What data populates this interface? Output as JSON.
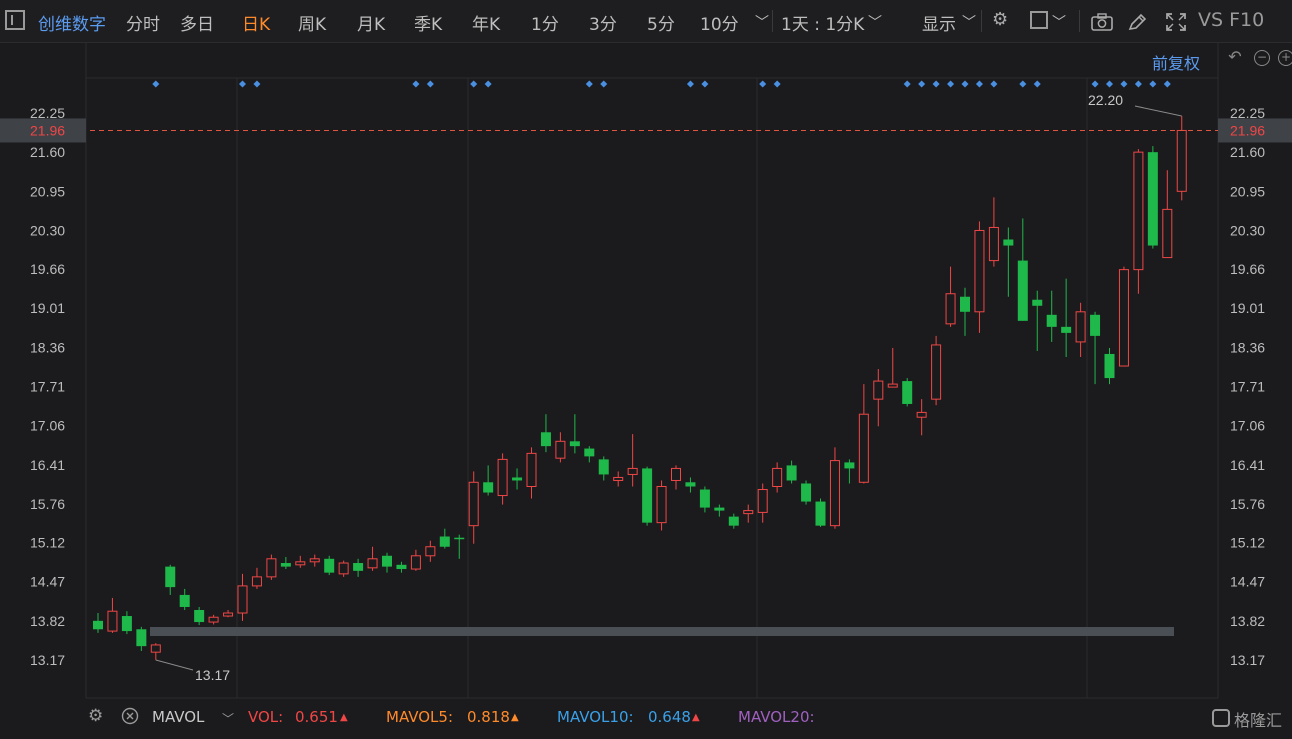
{
  "toolbar": {
    "stock_name": "创维数字",
    "periods": [
      "分时",
      "多日",
      "日K",
      "周K",
      "月K",
      "季K",
      "年K",
      "1分",
      "3分",
      "5分",
      "10分"
    ],
    "active_period": "日K",
    "more_chevron": "chevron-down-icon",
    "range": "1天 : 1分K",
    "display": "显示",
    "right_label": "VS F10",
    "icons": [
      "settings-icon",
      "checkbox-icon",
      "camera-icon",
      "pen-icon",
      "fullscreen-icon"
    ]
  },
  "subbar": {
    "adjust_label": "前复权",
    "icons": [
      "undo-icon",
      "zoom-out-icon",
      "zoom-in-icon"
    ]
  },
  "colors": {
    "up": "#f04646",
    "down": "#1fb84a",
    "price_line": "#e0553f",
    "marker": "#4a90e2",
    "grid": "#2b2b2e"
  },
  "chart_data": {
    "type": "candlestick",
    "y_ticks": [
      "22.25",
      "21.60",
      "20.95",
      "20.30",
      "19.66",
      "19.01",
      "18.36",
      "17.71",
      "17.06",
      "16.41",
      "15.76",
      "15.12",
      "14.47",
      "13.82",
      "13.17"
    ],
    "ylim": [
      12.6,
      22.6
    ],
    "current_price": "21.96",
    "high_label": "22.20",
    "low_label": "13.17",
    "candles": [
      [
        13.82,
        13.68,
        13.95,
        13.62
      ],
      [
        13.65,
        13.98,
        14.2,
        13.62
      ],
      [
        13.9,
        13.65,
        13.98,
        13.6
      ],
      [
        13.68,
        13.4,
        13.72,
        13.32
      ],
      [
        13.3,
        13.42,
        13.45,
        13.17
      ],
      [
        14.72,
        14.38,
        14.75,
        14.25
      ],
      [
        14.25,
        14.05,
        14.35,
        14.0
      ],
      [
        14.0,
        13.8,
        14.05,
        13.75
      ],
      [
        13.8,
        13.88,
        13.92,
        13.76
      ],
      [
        13.9,
        13.95,
        14.0,
        13.88
      ],
      [
        13.95,
        14.4,
        14.6,
        13.82
      ],
      [
        14.4,
        14.55,
        14.7,
        14.35
      ],
      [
        14.55,
        14.85,
        14.92,
        14.5
      ],
      [
        14.78,
        14.72,
        14.88,
        14.68
      ],
      [
        14.75,
        14.8,
        14.9,
        14.7
      ],
      [
        14.8,
        14.85,
        14.92,
        14.72
      ],
      [
        14.85,
        14.62,
        14.9,
        14.58
      ],
      [
        14.6,
        14.78,
        14.82,
        14.55
      ],
      [
        14.78,
        14.65,
        14.85,
        14.55
      ],
      [
        14.7,
        14.85,
        15.05,
        14.65
      ],
      [
        14.9,
        14.72,
        14.95,
        14.62
      ],
      [
        14.75,
        14.68,
        14.8,
        14.62
      ],
      [
        14.68,
        14.9,
        15.0,
        14.65
      ],
      [
        14.9,
        15.05,
        15.15,
        14.8
      ],
      [
        15.22,
        15.05,
        15.35,
        15.02
      ],
      [
        15.2,
        15.18,
        15.25,
        14.85
      ],
      [
        15.4,
        16.12,
        16.3,
        15.1
      ],
      [
        16.12,
        15.95,
        16.4,
        15.9
      ],
      [
        15.9,
        16.5,
        16.6,
        15.75
      ],
      [
        16.2,
        16.15,
        16.35,
        16.0
      ],
      [
        16.05,
        16.6,
        16.7,
        15.85
      ],
      [
        16.95,
        16.72,
        17.25,
        16.62
      ],
      [
        16.52,
        16.8,
        16.95,
        16.45
      ],
      [
        16.8,
        16.72,
        17.25,
        16.6
      ],
      [
        16.68,
        16.55,
        16.72,
        16.45
      ],
      [
        16.5,
        16.25,
        16.55,
        16.15
      ],
      [
        16.15,
        16.2,
        16.3,
        16.05
      ],
      [
        16.25,
        16.35,
        16.92,
        16.05
      ],
      [
        16.35,
        15.45,
        16.38,
        15.4
      ],
      [
        15.45,
        16.05,
        16.15,
        15.32
      ],
      [
        16.15,
        16.35,
        16.4,
        16.0
      ],
      [
        16.12,
        16.05,
        16.2,
        15.95
      ],
      [
        16.0,
        15.7,
        16.05,
        15.62
      ],
      [
        15.7,
        15.65,
        15.75,
        15.55
      ],
      [
        15.55,
        15.4,
        15.6,
        15.35
      ],
      [
        15.6,
        15.65,
        15.75,
        15.45
      ],
      [
        15.62,
        16.0,
        16.1,
        15.45
      ],
      [
        16.05,
        16.35,
        16.45,
        15.95
      ],
      [
        16.4,
        16.15,
        16.48,
        16.1
      ],
      [
        16.1,
        15.8,
        16.15,
        15.75
      ],
      [
        15.8,
        15.4,
        15.85,
        15.38
      ],
      [
        15.4,
        16.48,
        16.7,
        15.35
      ],
      [
        16.45,
        16.35,
        16.5,
        16.1
      ],
      [
        16.12,
        17.25,
        17.75,
        16.1
      ],
      [
        17.5,
        17.8,
        18.0,
        17.05
      ],
      [
        17.7,
        17.75,
        18.35,
        17.7
      ],
      [
        17.8,
        17.42,
        17.85,
        17.38
      ],
      [
        17.2,
        17.28,
        17.5,
        16.9
      ],
      [
        17.5,
        18.4,
        18.55,
        17.4
      ],
      [
        18.75,
        19.25,
        19.7,
        18.7
      ],
      [
        19.2,
        18.95,
        19.35,
        18.55
      ],
      [
        18.95,
        20.3,
        20.45,
        18.6
      ],
      [
        19.8,
        20.35,
        20.85,
        19.7
      ],
      [
        20.15,
        20.05,
        20.35,
        19.2
      ],
      [
        19.8,
        18.8,
        20.5,
        18.8
      ],
      [
        19.15,
        19.05,
        19.3,
        18.3
      ],
      [
        18.9,
        18.7,
        19.3,
        18.45
      ],
      [
        18.7,
        18.6,
        19.5,
        18.2
      ],
      [
        18.45,
        18.95,
        19.1,
        18.2
      ],
      [
        18.9,
        18.55,
        18.95,
        17.75
      ],
      [
        18.25,
        17.85,
        18.35,
        17.75
      ],
      [
        18.05,
        19.65,
        19.7,
        18.05
      ],
      [
        19.65,
        21.6,
        21.65,
        19.25
      ],
      [
        21.6,
        20.05,
        21.7,
        20.0
      ],
      [
        19.85,
        20.65,
        21.3,
        19.85
      ],
      [
        20.95,
        21.96,
        22.2,
        20.8
      ]
    ],
    "marker_indices": [
      4,
      10,
      11,
      22,
      23,
      26,
      27,
      34,
      35,
      41,
      42,
      46,
      47,
      56,
      57,
      58,
      59,
      60,
      61,
      62,
      64,
      65,
      69,
      70,
      71,
      72,
      73,
      74
    ]
  },
  "volume": {
    "icons": [
      "settings-icon",
      "close-icon"
    ],
    "indicator": "MAVOL",
    "vol_label": "VOL:",
    "vol_value": "0.651",
    "mavol5_label": "MAVOL5:",
    "mavol5_value": "0.818",
    "mavol10_label": "MAVOL10:",
    "mavol10_value": "0.648",
    "mavol20_label": "MAVOL20:",
    "mavol20_value": "",
    "arrow": "▲",
    "colors": {
      "vol": "#f04646",
      "mavol5": "#ff8a2a",
      "mavol10": "#3aa0e8",
      "mavol20": "#a060c0"
    },
    "watermark": "格隆汇"
  }
}
